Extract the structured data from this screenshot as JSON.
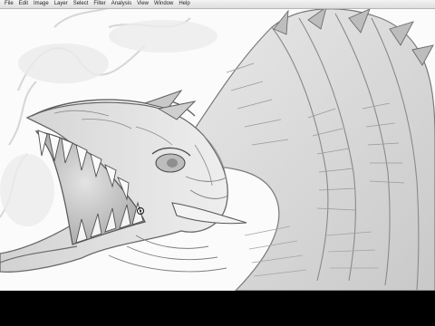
{
  "menubar": {
    "items": [
      {
        "label": "File"
      },
      {
        "label": "Edit"
      },
      {
        "label": "Image"
      },
      {
        "label": "Layer"
      },
      {
        "label": "Select"
      },
      {
        "label": "Filter"
      },
      {
        "label": "Analysis"
      },
      {
        "label": "View"
      },
      {
        "label": "Window"
      },
      {
        "label": "Help"
      }
    ]
  },
  "canvas": {
    "background_color": "#fbfbfb",
    "stroke_color": "#555555",
    "subject": "pencil sketch of a roaring dragon head"
  },
  "cursor": {
    "icon": "brush-cursor-icon"
  }
}
